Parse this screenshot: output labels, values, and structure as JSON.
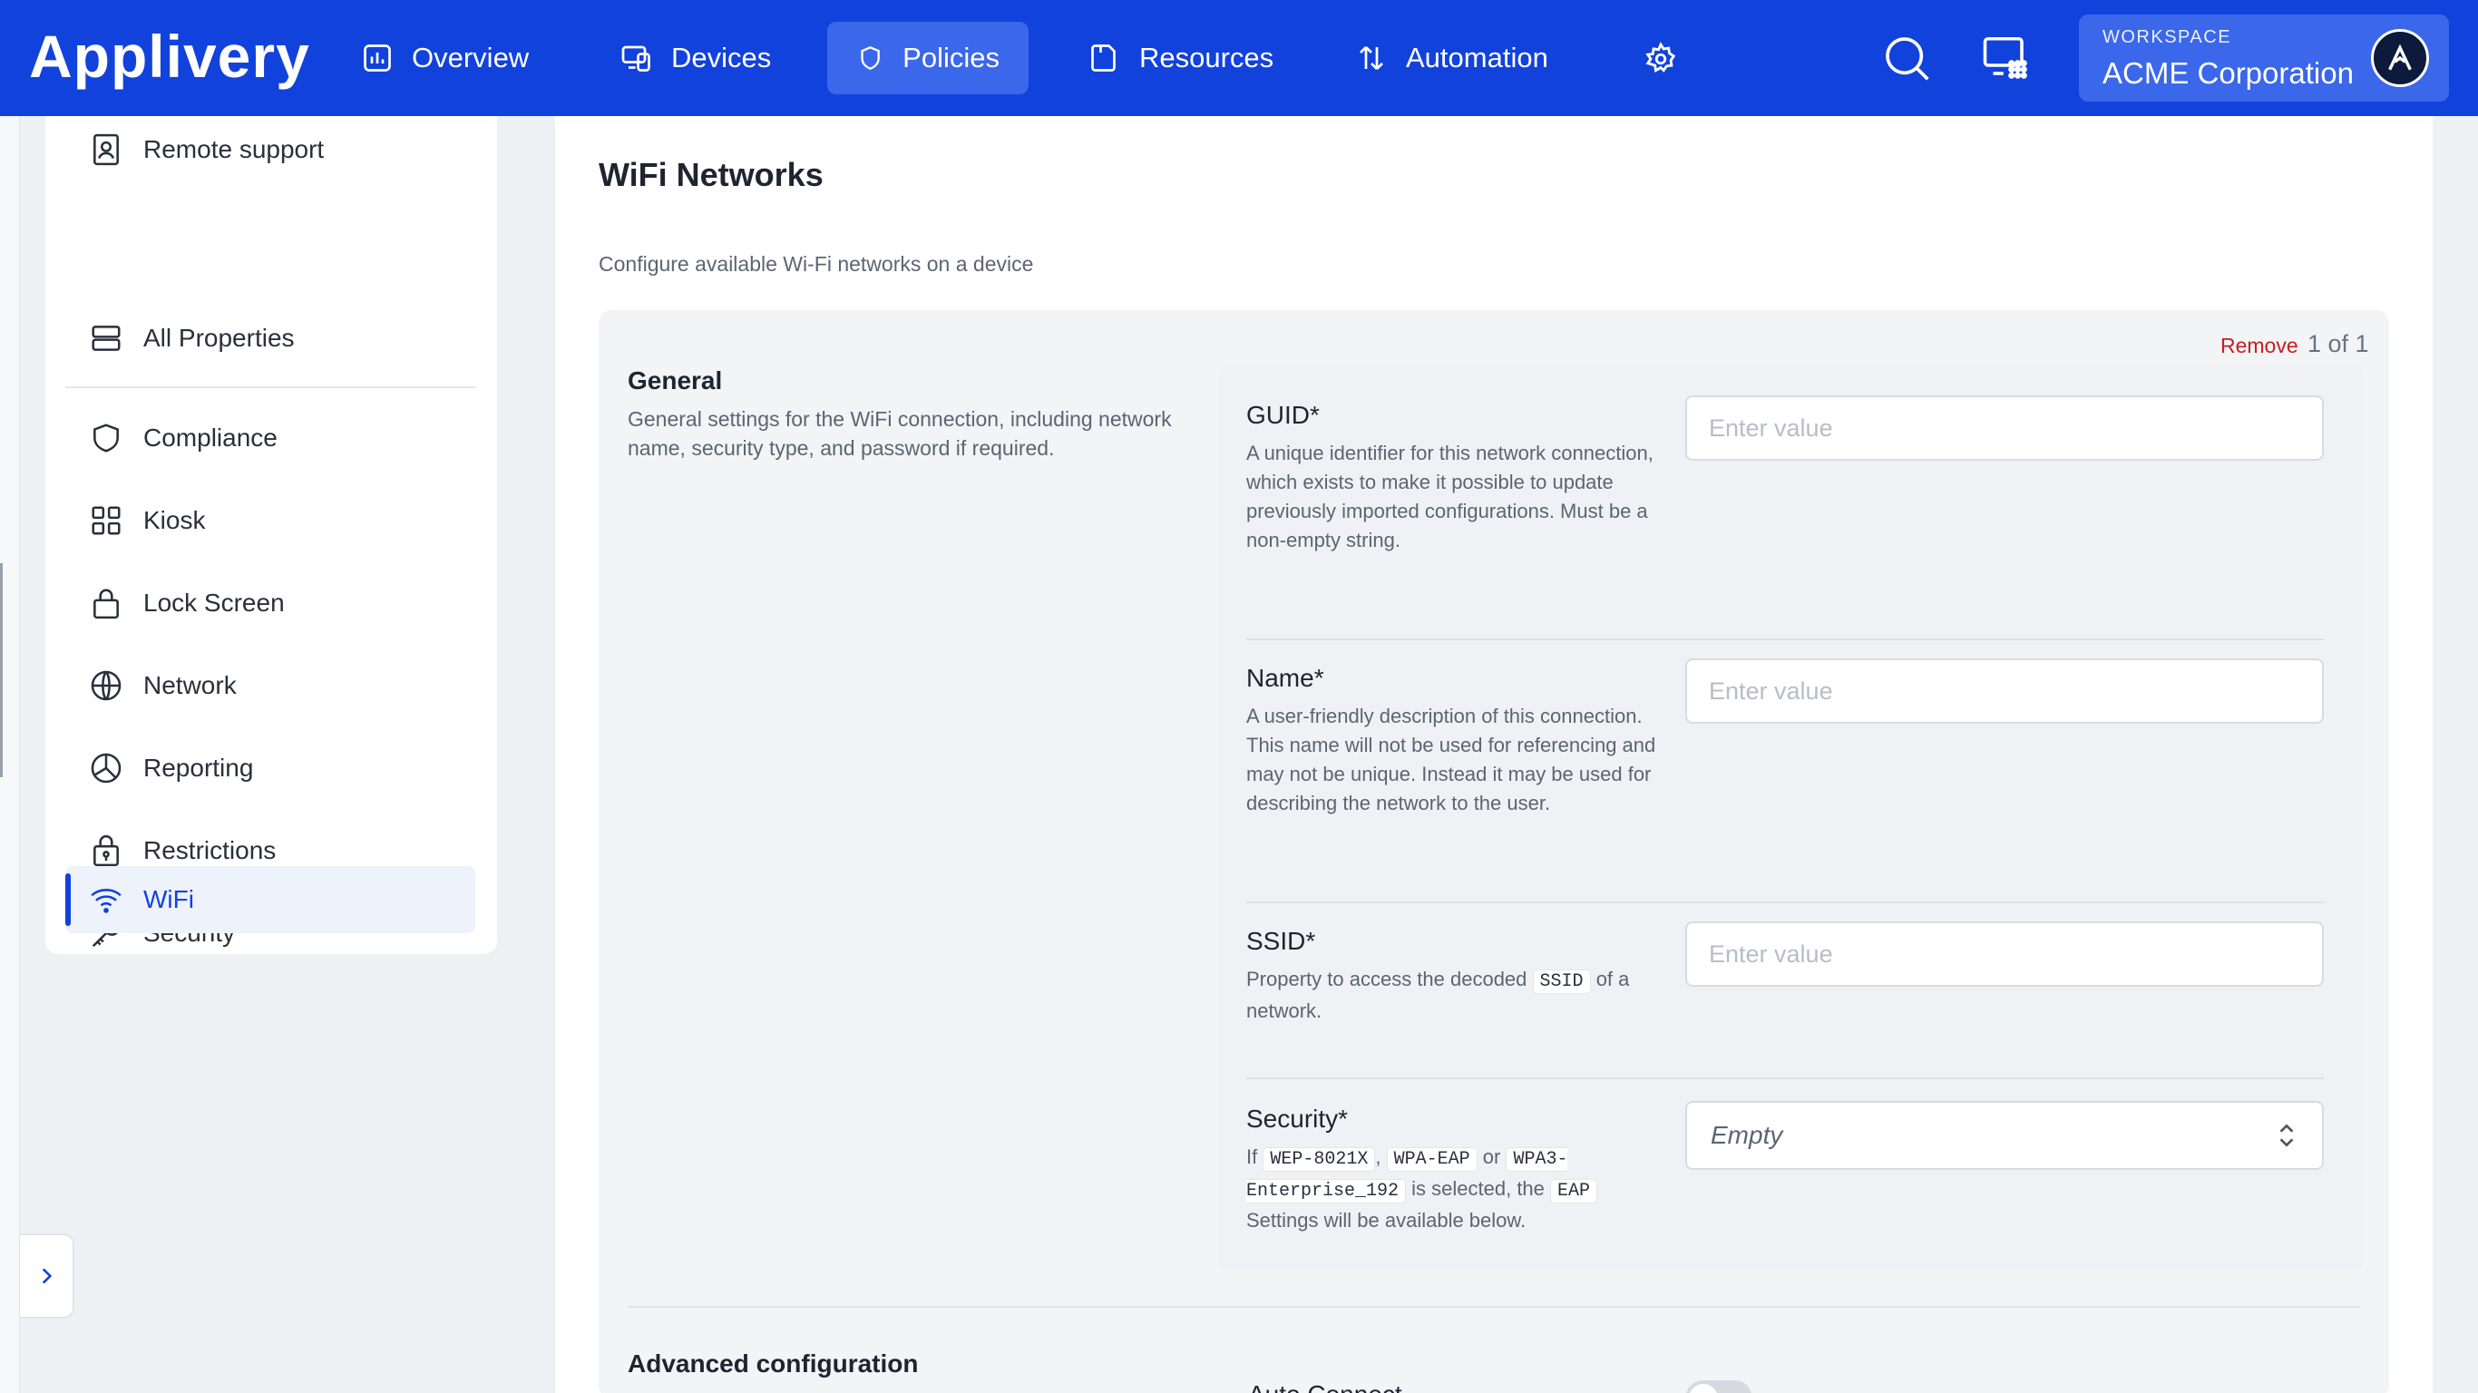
{
  "app": {
    "logo": "Applivery"
  },
  "nav": {
    "items": [
      {
        "label": "Overview",
        "icon": "chart-icon"
      },
      {
        "label": "Devices",
        "icon": "devices-icon"
      },
      {
        "label": "Policies",
        "icon": "shield-icon",
        "active": true
      },
      {
        "label": "Resources",
        "icon": "folder-icon"
      },
      {
        "label": "Automation",
        "icon": "automation-icon"
      }
    ],
    "settings_icon": "gear-icon",
    "search_icon": "search-icon",
    "grid_icon": "grid-icon"
  },
  "workspace": {
    "label": "WORKSPACE",
    "name": "ACME Corporation"
  },
  "sidebar": {
    "items": [
      {
        "label": "Remote support",
        "icon": "remote-support-icon"
      },
      {
        "label": "All Properties",
        "icon": "properties-icon"
      },
      {
        "label": "Compliance",
        "icon": "shield-icon"
      },
      {
        "label": "Kiosk",
        "icon": "kiosk-icon"
      },
      {
        "label": "Lock Screen",
        "icon": "lock-icon"
      },
      {
        "label": "Network",
        "icon": "globe-icon"
      },
      {
        "label": "Reporting",
        "icon": "pie-chart-icon"
      },
      {
        "label": "Restrictions",
        "icon": "lock-badge-icon"
      },
      {
        "label": "Security",
        "icon": "key-icon"
      },
      {
        "label": "WiFi",
        "icon": "wifi-icon",
        "active": true
      }
    ]
  },
  "main": {
    "title": "WiFi Networks",
    "description": "Configure available Wi-Fi networks on a device",
    "card": {
      "remove_label": "Remove",
      "counter": "1 of 1",
      "general": {
        "title": "General",
        "description": "General settings for the WiFi connection, including network name, security type, and password if required."
      },
      "fields": {
        "guid": {
          "label": "GUID*",
          "help": "A unique identifier for this network connection, which exists to make it possible to update previously imported configurations. Must be a non-empty string.",
          "placeholder": "Enter value"
        },
        "name": {
          "label": "Name*",
          "help": "A user-friendly description of this connection. This name will not be used for referencing and may not be unique. Instead it may be used for describing the network to the user.",
          "placeholder": "Enter value"
        },
        "ssid": {
          "label": "SSID*",
          "help_before": "Property to access the decoded",
          "help_code": "SSID",
          "help_after": "of a network.",
          "placeholder": "Enter value"
        },
        "security": {
          "label": "Security*",
          "help_if": "If",
          "code1": "WEP-8021X",
          "comma": ",",
          "code2": "WPA-EAP",
          "or": "or",
          "code3": "WPA3-Enterprise_192",
          "is_selected": "is selected, the",
          "code4": "EAP",
          "help_end": "Settings will be available below.",
          "value": "Empty"
        }
      },
      "advanced": {
        "title": "Advanced configuration",
        "first_field": "Auto Connect"
      }
    }
  },
  "colors": {
    "brand": "#1242dc",
    "brand_active": "#3b67ea",
    "danger": "#c81e1e"
  }
}
